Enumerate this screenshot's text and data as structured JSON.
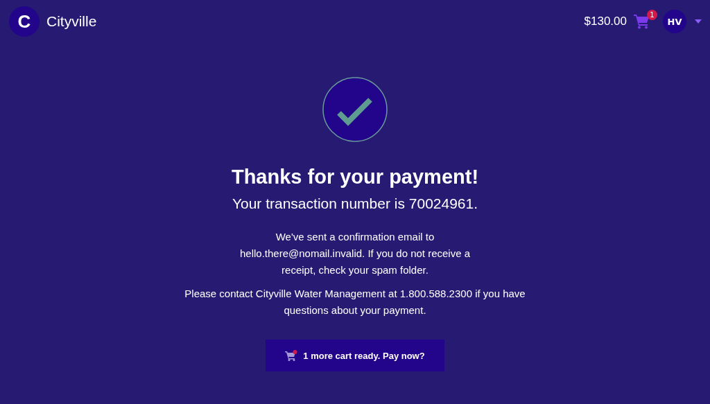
{
  "header": {
    "logo_letter": "C",
    "brand": "Cityville",
    "cart_total": "$130.00",
    "cart_count": "1",
    "avatar": "HV"
  },
  "confirmation": {
    "title": "Thanks for your payment!",
    "transaction": "Your transaction number is 70024961.",
    "email_note": "We've sent a confirmation email to hello.there@nomail.invalid. If you do not receive a receipt, check your spam folder.",
    "contact_note": "Please contact Cityville Water Management at 1.800.588.2300 if you have questions about your payment.",
    "button": "1 more cart ready. Pay now?"
  }
}
